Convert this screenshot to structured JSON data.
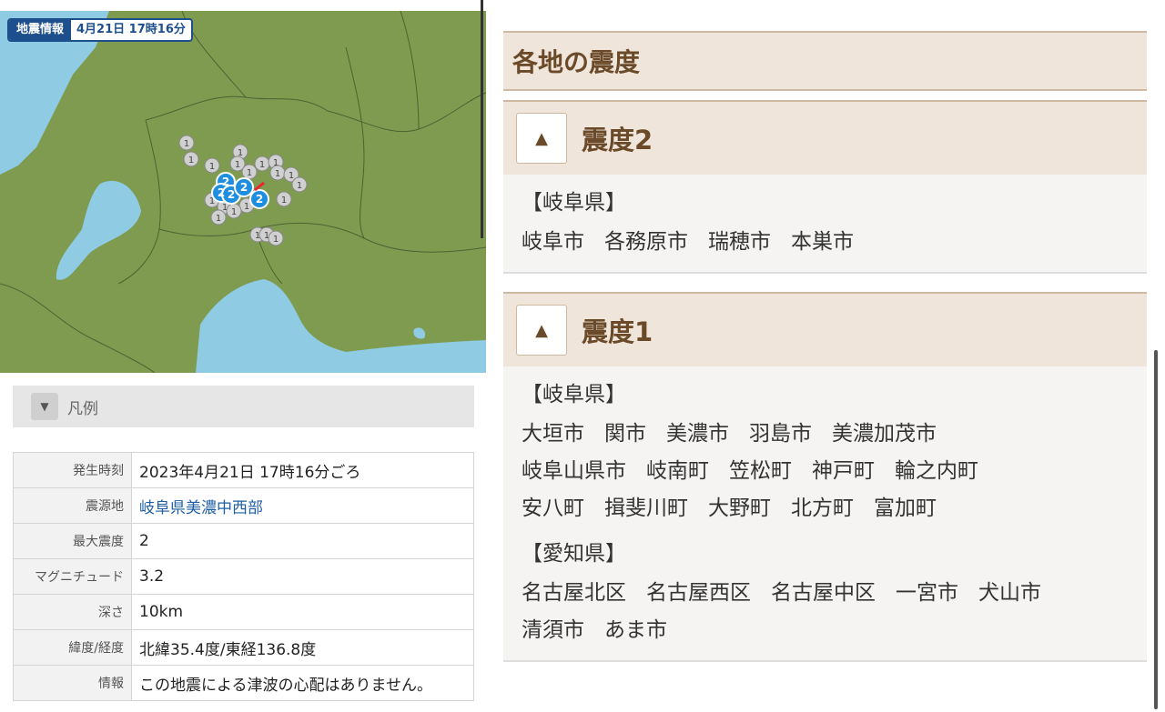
{
  "map": {
    "tag_label": "地震情報",
    "tag_time": "4月21日 17時16分",
    "markers": [
      {
        "label": "1",
        "color": "#c8c8c8"
      },
      {
        "label": "2",
        "color": "#1e8ee0"
      }
    ]
  },
  "legend": {
    "label": "凡例",
    "icon": "triangle-down-icon"
  },
  "info": {
    "rows": [
      {
        "key": "発生時刻",
        "value": "2023年4月21日 17時16分ごろ"
      },
      {
        "key": "震源地",
        "value": "岐阜県美濃中西部"
      },
      {
        "key": "最大震度",
        "value": "2"
      },
      {
        "key": "マグニチュード",
        "value": "3.2"
      },
      {
        "key": "深さ",
        "value": "10km"
      },
      {
        "key": "緯度/経度",
        "value": "北緯35.4度/東経136.8度"
      },
      {
        "key": "情報",
        "value": "この地震による津波の心配はありません。"
      }
    ]
  },
  "intensity": {
    "title": "各地の震度",
    "sections": [
      {
        "label": "震度2",
        "toggle_icon": "triangle-up-icon",
        "groups": [
          {
            "pref": "【岐阜県】",
            "cities": [
              "岐阜市",
              "各務原市",
              "瑞穂市",
              "本巣市"
            ]
          }
        ]
      },
      {
        "label": "震度1",
        "toggle_icon": "triangle-up-icon",
        "groups": [
          {
            "pref": "【岐阜県】",
            "cities": [
              "大垣市",
              "関市",
              "美濃市",
              "羽島市",
              "美濃加茂市",
              "岐阜山県市",
              "岐南町",
              "笠松町",
              "神戸町",
              "輪之内町",
              "安八町",
              "揖斐川町",
              "大野町",
              "北方町",
              "富加町"
            ]
          },
          {
            "pref": "【愛知県】",
            "cities": [
              "名古屋北区",
              "名古屋西区",
              "名古屋中区",
              "一宮市",
              "犬山市",
              "清須市",
              "あま市"
            ]
          }
        ]
      }
    ]
  },
  "colors": {
    "accent_brown": "#6b4a2a",
    "head_bg": "#efe5da",
    "map_land": "#7e9b4f",
    "map_water": "#8fcbe3",
    "link_blue": "#1f5fa6"
  }
}
